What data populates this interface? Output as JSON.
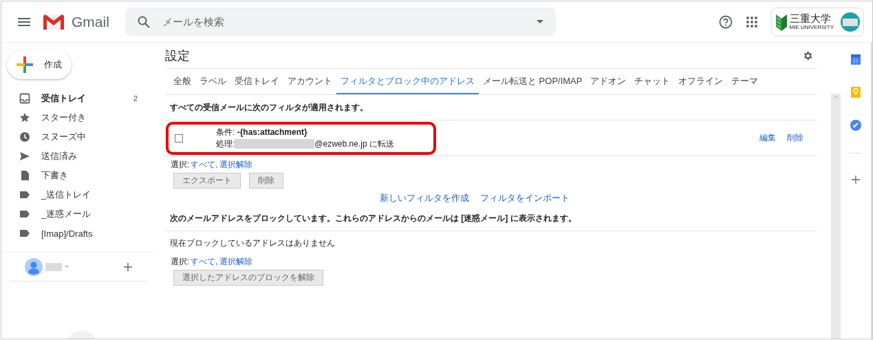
{
  "header": {
    "app_name": "Gmail",
    "search": {
      "placeholder": "メールを検索"
    },
    "logo": {
      "title": "三重大学",
      "subtitle": "MIE UNIVERSITY"
    }
  },
  "compose": {
    "label": "作成"
  },
  "sidebar": {
    "items": [
      {
        "kind": "inbox",
        "label": "受信トレイ",
        "count": "2",
        "bold": true
      },
      {
        "kind": "star",
        "label": "スター付き",
        "bold": false
      },
      {
        "kind": "clock",
        "label": "スヌーズ中",
        "bold": false
      },
      {
        "kind": "send",
        "label": "送信済み",
        "bold": false
      },
      {
        "kind": "draft",
        "label": "下書き",
        "bold": false
      },
      {
        "kind": "label",
        "label": "_送信トレイ",
        "bold": false
      },
      {
        "kind": "label",
        "label": "_迷惑メール",
        "bold": false
      },
      {
        "kind": "label",
        "label": "[Imap]/Drafts",
        "bold": false
      }
    ]
  },
  "settings": {
    "title": "設定",
    "tabs": [
      {
        "label": "全般",
        "selected": false
      },
      {
        "label": "ラベル",
        "selected": false
      },
      {
        "label": "受信トレイ",
        "selected": false
      },
      {
        "label": "アカウント",
        "selected": false
      },
      {
        "label": "フィルタとブロック中のアドレス",
        "selected": true
      },
      {
        "label": "メール転送と POP/IMAP",
        "selected": false
      },
      {
        "label": "アドオン",
        "selected": false
      },
      {
        "label": "チャット",
        "selected": false
      },
      {
        "label": "オフライン",
        "selected": false
      },
      {
        "label": "テーマ",
        "selected": false
      }
    ],
    "filters": {
      "heading": "すべての受信メールに次のフィルタが適用されます。",
      "items": [
        {
          "checked": false,
          "condition": "条件: **-{has:attachment}**",
          "action_label": "処理:",
          "action_value": "@ezweb.ne.jp に転送",
          "edit": "編集",
          "delete": "削除",
          "highlighted": true
        }
      ],
      "select_label": "選択:",
      "select_all": "すべて,",
      "select_none": "選択解除",
      "buttons": [
        "エクスポート",
        "削除"
      ],
      "links": [
        "新しいフィルタを作成",
        "フィルタをインポート"
      ]
    },
    "blocked": {
      "heading": "次のメールアドレスをブロックしています。これらのアドレスからのメールは [迷惑メール] に表示されます。",
      "empty_text": "現在ブロックしているアドレスはありません",
      "select_label": "選択:",
      "select_all": "すべて,",
      "select_none": "選択解除",
      "buttons": [
        "選択したアドレスのブロックを解除"
      ]
    }
  }
}
